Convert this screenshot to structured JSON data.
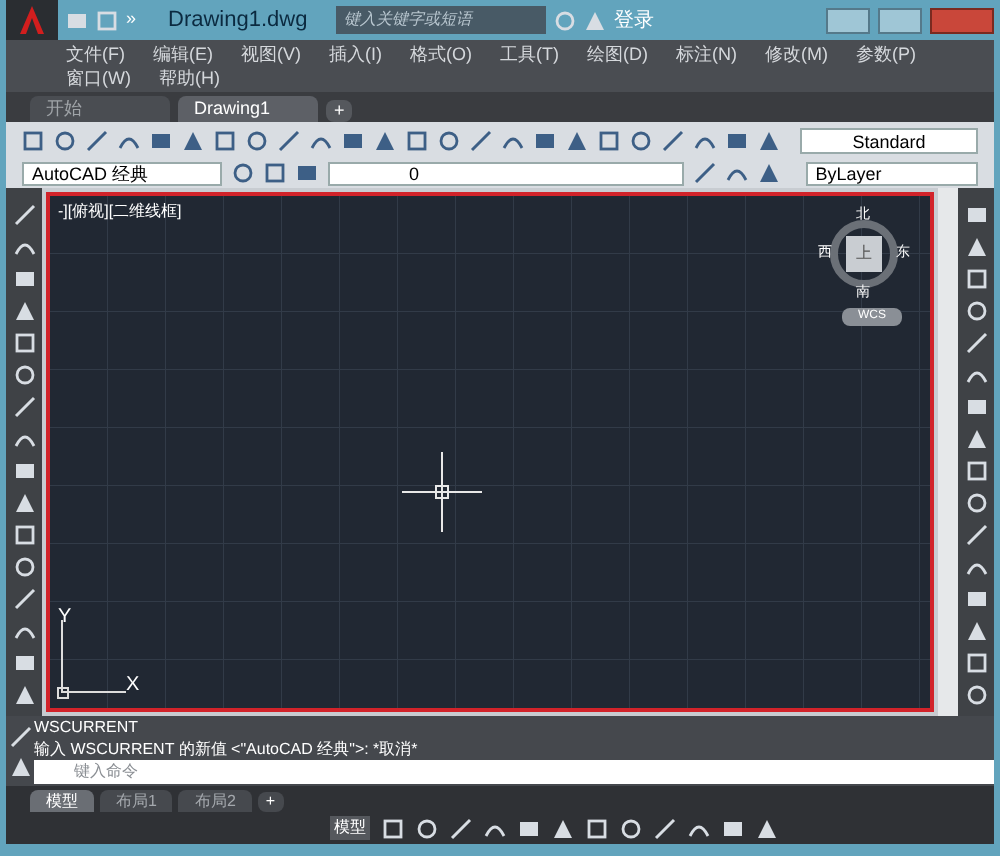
{
  "title_bar": {
    "quick_access_more": "»",
    "document_title": "Drawing1.dwg",
    "search": {
      "placeholder": "键入关键字或短语"
    },
    "user": "登录"
  },
  "menu": [
    {
      "label": "文件(F)"
    },
    {
      "label": "编辑(E)"
    },
    {
      "label": "视图(V)"
    },
    {
      "label": "插入(I)"
    },
    {
      "label": "格式(O)"
    },
    {
      "label": "工具(T)"
    },
    {
      "label": "绘图(D)"
    },
    {
      "label": "标注(N)"
    },
    {
      "label": "修改(M)"
    },
    {
      "label": "参数(P)"
    },
    {
      "label": "窗口(W)"
    },
    {
      "label": "帮助(H)"
    }
  ],
  "document_tabs": [
    {
      "label": "开始",
      "selected": false
    },
    {
      "label": "Drawing1",
      "selected": true
    }
  ],
  "new_tab": "+",
  "toolbar": {
    "text_style": "Standard",
    "workspace": "AutoCAD 经典",
    "layer": "0",
    "color_control": "ByLayer"
  },
  "viewport": {
    "label": "-][俯视][二维线框]",
    "viewcube": {
      "top": "上",
      "north": "北",
      "south": "南",
      "east": "东",
      "west": "西",
      "ucs": "WCS"
    },
    "ucs_axes": {
      "x": "X",
      "y": "Y"
    }
  },
  "command": {
    "history": [
      "WSCURRENT",
      "输入 WSCURRENT 的新值 <\"AutoCAD 经典\">: *取消*"
    ],
    "placeholder": "键入命令"
  },
  "layout_tabs": [
    {
      "label": "模型",
      "selected": true
    },
    {
      "label": "布局1",
      "selected": false
    },
    {
      "label": "布局2",
      "selected": false
    }
  ],
  "layout_add": "+",
  "status_bar": {
    "model": "模型"
  }
}
